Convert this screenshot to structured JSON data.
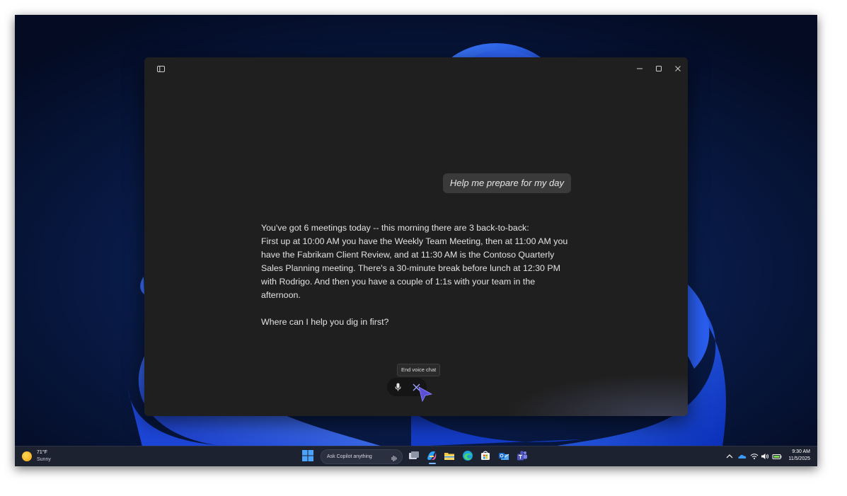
{
  "window": {
    "user_message": "Help me prepare for my day",
    "reply_paragraph_1_line_1": "You've got 6 meetings today -- this morning there are 3 back-to-back:",
    "reply_paragraph_1_rest": "First up at 10:00 AM you have the Weekly Team Meeting, then at 11:00 AM you have the Fabrikam Client Review, and at 11:30 AM is the Contoso Quarterly Sales Planning meeting. There's a 30-minute break before lunch at 12:30 PM with Rodrigo. And then you have a couple of 1:1s with your team in the afternoon.",
    "reply_paragraph_2": "Where can I help you dig in first?",
    "tooltip": "End voice chat"
  },
  "taskbar": {
    "weather_temp": "71°F",
    "weather_condition": "Sunny",
    "search_placeholder": "Ask Copilot anything",
    "time": "9:30 AM",
    "date": "11/5/2025"
  },
  "colors": {
    "window_bg": "#1f1f1f",
    "bubble_bg": "#3a3a3a",
    "taskbar_bg": "#1c2230",
    "cursor_accent": "#5b4fd6"
  },
  "icons": [
    "sidebar-toggle-icon",
    "minimize-icon",
    "maximize-icon",
    "close-icon",
    "microphone-icon",
    "end-voice-icon",
    "windows-start-icon",
    "copilot-icon",
    "file-explorer-icon",
    "edge-icon",
    "store-icon",
    "outlook-icon",
    "teams-icon",
    "onedrive-icon",
    "wifi-icon",
    "volume-icon",
    "battery-icon"
  ]
}
